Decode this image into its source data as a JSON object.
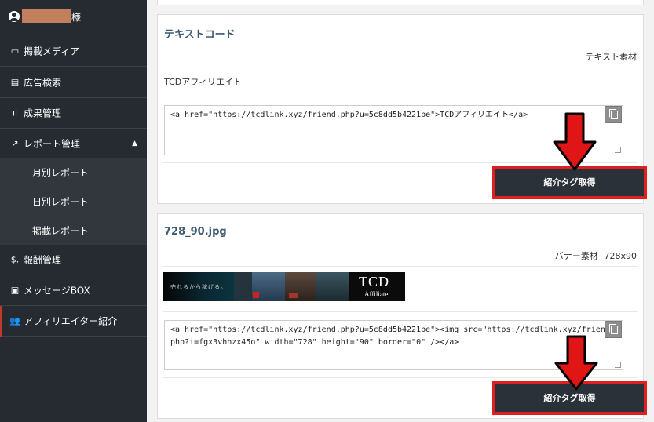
{
  "sidebar": {
    "user_suffix": "様",
    "items": [
      {
        "icon": "▭",
        "label": "掲載メディア"
      },
      {
        "icon": "▤",
        "label": "広告検索"
      },
      {
        "icon": "ıl",
        "label": "成果管理"
      },
      {
        "icon": "↗",
        "label": "レポート管理",
        "expanded": true
      },
      {
        "icon": "$.",
        "label": "報酬管理"
      },
      {
        "icon": "▣",
        "label": "メッセージBOX"
      },
      {
        "icon": "👥",
        "label": "アフィリエイター紹介",
        "active": true
      }
    ],
    "subitems": [
      "月別レポート",
      "日別レポート",
      "掲載レポート"
    ],
    "accent_color": "#c0392b"
  },
  "cards": [
    {
      "title": "テキストコード",
      "type_label": "テキスト素材",
      "text": "TCDアフィリエイト",
      "code": "<a href=\"https://tcdlink.xyz/friend.php?u=5c8dd5b4221be\">TCDアフィリエイト</a>",
      "button": "紹介タグ取得"
    },
    {
      "title": "728_90.jpg",
      "type_label": "バナー素材",
      "size": "728x90",
      "banner_caption": "売れるから稼げる。",
      "banner_brand": "TCD",
      "banner_sub": "Affiliate",
      "code": "<a href=\"https://tcdlink.xyz/friend.php?u=5c8dd5b4221be\"><img src=\"https://tcdlink.xyz/friend.php?i=fgx3vhhzx45o\" width=\"728\" height=\"90\" border=\"0\" /></a>",
      "button": "紹介タグ取得"
    }
  ],
  "highlight_color": "#e02020"
}
